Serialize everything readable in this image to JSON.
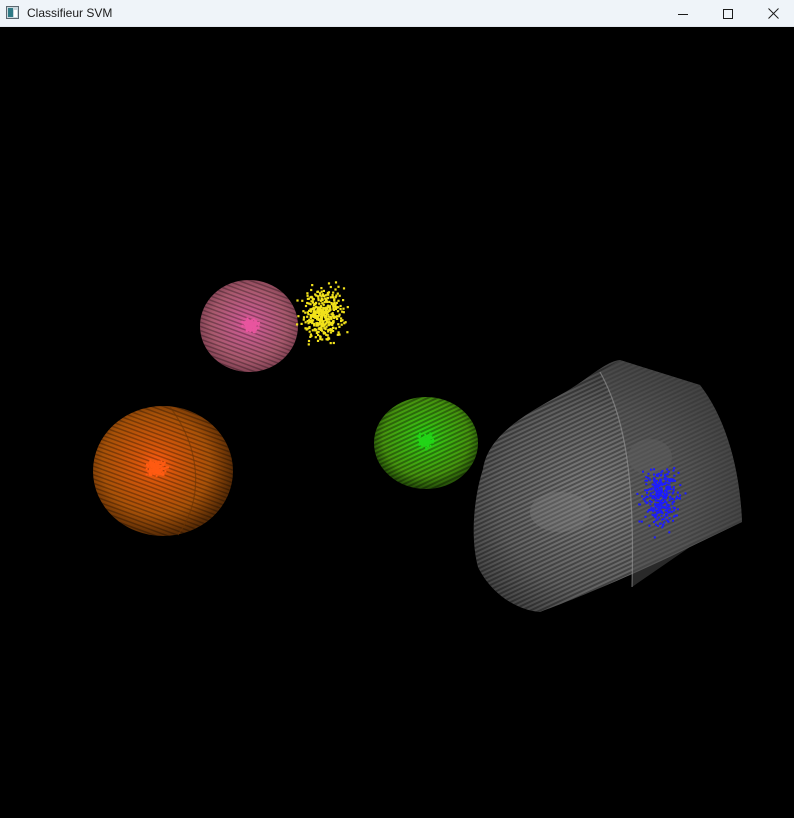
{
  "window": {
    "title": "Classifieur SVM",
    "icon": "app-window-icon",
    "controls": {
      "minimize_icon": "minimize-icon",
      "maximize_icon": "maximize-icon",
      "close_icon": "close-icon"
    }
  },
  "scene": {
    "background": "#000000",
    "class_colors": {
      "pink": "#e8559f",
      "orange": "#ff5a12",
      "green": "#22d417",
      "blue": "#1c1cff",
      "yellow": "#f2e21b"
    },
    "surface_colors": {
      "pink": "#b35d73",
      "orange": "#b6580a",
      "green": "#4fae12",
      "gray": "#7a7a7a"
    }
  }
}
